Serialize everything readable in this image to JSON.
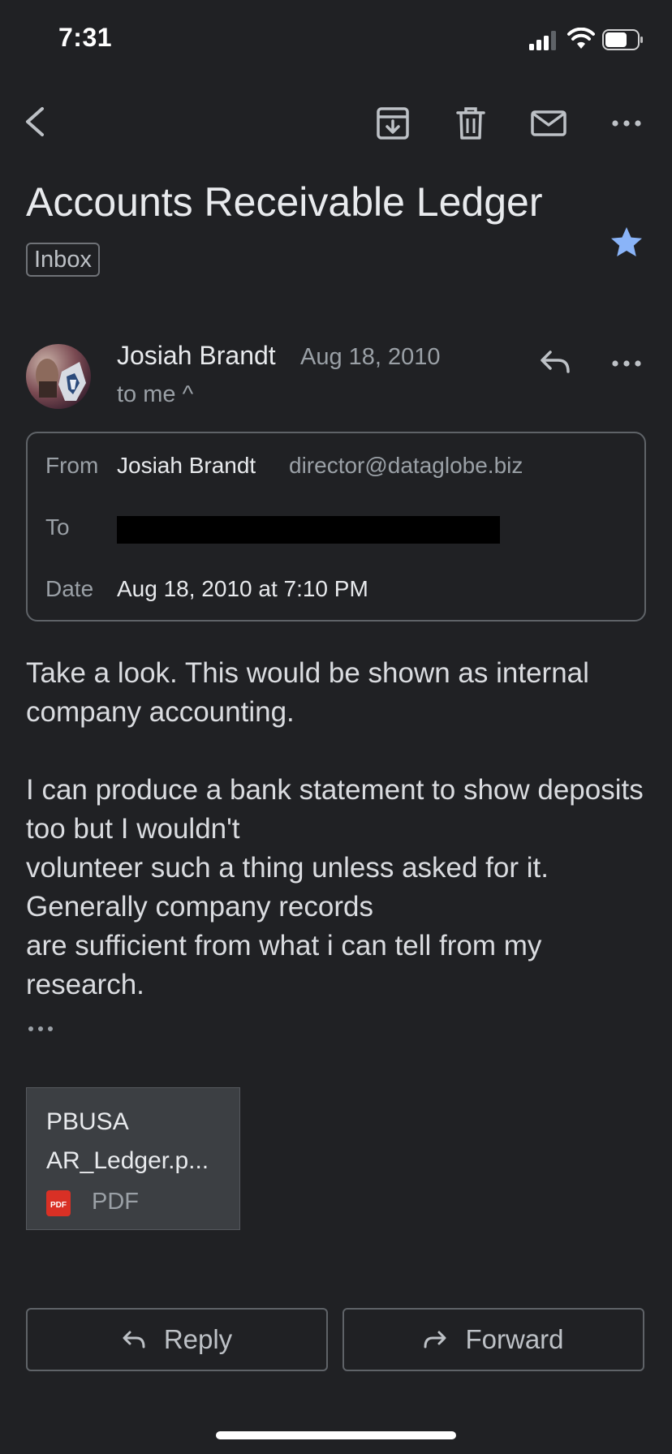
{
  "status_bar": {
    "time": "7:31"
  },
  "subject": "Accounts Receivable Ledger",
  "label": "Inbox",
  "sender": {
    "name": "Josiah Brandt",
    "date": "Aug 18, 2010",
    "to_me": "to me ^"
  },
  "details": {
    "from_label": "From",
    "from_name": "Josiah Brandt",
    "from_email": "director@dataglobe.biz",
    "to_label": "To",
    "date_label": "Date",
    "date_value": "Aug 18, 2010 at 7:10 PM"
  },
  "body": "Take a look. This would be shown as internal company accounting.\n\nI can produce a bank statement to show deposits too but I wouldn't\nvolunteer such a thing unless asked for it. Generally company records\nare sufficient from what i can tell from my research.",
  "attachment": {
    "name_line1": "PBUSA",
    "name_line2": "AR_Ledger.p...",
    "type": "PDF",
    "badge": "PDF"
  },
  "actions": {
    "reply": "Reply",
    "forward": "Forward"
  },
  "colors": {
    "background": "#202124",
    "star": "#8ab4f8",
    "pdf_badge": "#d93025"
  }
}
